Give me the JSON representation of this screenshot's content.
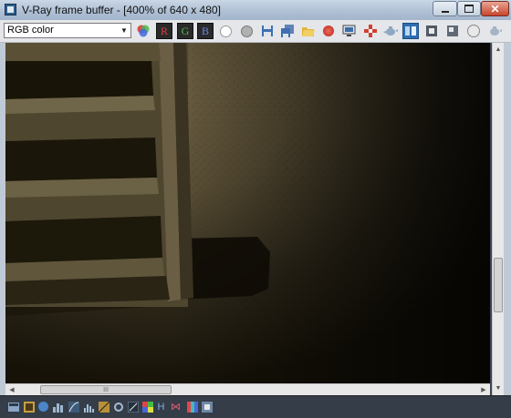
{
  "window": {
    "title": "V-Ray frame buffer - [400% of 640 x 480]",
    "close_glyph": "✕"
  },
  "toolbar": {
    "channel_select": {
      "value": "RGB color",
      "arrow": "▼"
    },
    "channel_buttons": [
      {
        "label": "R",
        "color": "#e04040"
      },
      {
        "label": "G",
        "color": "#48c048"
      },
      {
        "label": "B",
        "color": "#6a8ae8"
      }
    ]
  },
  "scrollbars": {
    "vertical": {
      "up": "▲",
      "down": "▼"
    },
    "horizontal": {
      "left": "◀",
      "right": "▶",
      "grip": "III"
    }
  },
  "bottom_toolbar": {
    "glyphs": [
      "H",
      "⋈"
    ]
  },
  "colors": {
    "accent_blue": "#2f6db0",
    "render_dark": "#1a1608",
    "render_light": "#6b5e3e"
  }
}
